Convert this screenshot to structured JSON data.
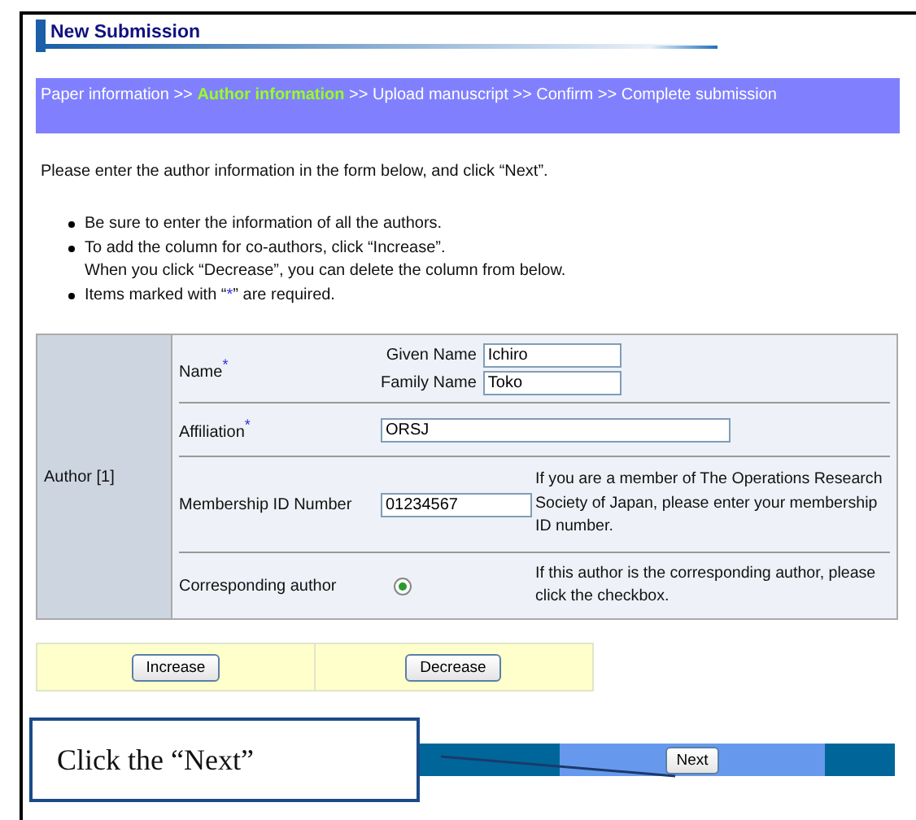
{
  "title": "New Submission",
  "steps": [
    {
      "label": "Paper information",
      "selected": false
    },
    {
      "label": "Author information",
      "selected": true
    },
    {
      "label": "Upload manuscript",
      "selected": false
    },
    {
      "label": "Confirm",
      "selected": false
    },
    {
      "label": "Complete submission",
      "selected": false
    }
  ],
  "step_separator": ">>",
  "intro": "Please enter the author information in the form below, and click “Next”.",
  "bullets": [
    {
      "lines": [
        [
          {
            "text": "Be sure to enter the information of all the authors."
          }
        ]
      ]
    },
    {
      "lines": [
        [
          {
            "text": "To add the column for co-authors, click “Increase”."
          }
        ],
        [
          {
            "text": "When you click “Decrease”, you can delete the column from below."
          }
        ]
      ]
    },
    {
      "lines": [
        [
          {
            "text": "Items marked with “"
          },
          {
            "text": "*",
            "accent": true
          },
          {
            "text": "” are required."
          }
        ]
      ]
    }
  ],
  "author": {
    "label": "Author [1]",
    "name": {
      "label": "Name",
      "mark": "*",
      "given_label": "Given Name",
      "given": "Ichiro",
      "family_label": "Family Name",
      "family": "Toko"
    },
    "affiliation": {
      "label": "Affiliation",
      "mark": "*",
      "value": "ORSJ"
    },
    "membership": {
      "label": "Membership ID Number",
      "value": "01234567",
      "note": "If you are a member of The Operations Research Society of Japan, please enter your membership ID number."
    },
    "corresponding": {
      "label": "Corresponding author",
      "selected": true,
      "note": "If this author is the corresponding author, please click the checkbox."
    }
  },
  "buttons": [
    {
      "label": "Increase"
    },
    {
      "label": "Decrease"
    }
  ],
  "next": "Next",
  "callout": "Click the “Next”"
}
